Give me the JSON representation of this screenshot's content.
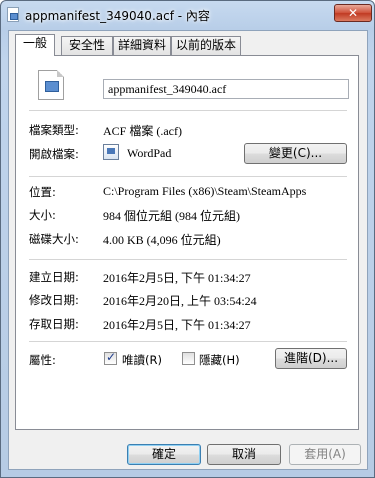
{
  "window": {
    "title": "appmanifest_349040.acf - 內容",
    "close_label": "✕"
  },
  "tabs": [
    {
      "label": "一般",
      "active": true
    },
    {
      "label": "安全性",
      "active": false
    },
    {
      "label": "詳細資料",
      "active": false
    },
    {
      "label": "以前的版本",
      "active": false
    }
  ],
  "general": {
    "file_name": "appmanifest_349040.acf",
    "type_label": "檔案類型:",
    "type_value": "ACF 檔案 (.acf)",
    "opens_with_label": "開啟檔案:",
    "opens_with_value": "WordPad",
    "change_button": "變更(C)...",
    "location_label": "位置:",
    "location_value": "C:\\Program Files (x86)\\Steam\\SteamApps",
    "size_label": "大小:",
    "size_value": "984 個位元組 (984 位元組)",
    "disk_size_label": "磁碟大小:",
    "disk_size_value": "4.00 KB (4,096 位元組)",
    "created_label": "建立日期:",
    "created_value": "2016年2月5日, 下午 01:34:27",
    "modified_label": "修改日期:",
    "modified_value": "2016年2月20日, 上午 03:54:24",
    "accessed_label": "存取日期:",
    "accessed_value": "2016年2月5日, 下午 01:34:27",
    "attributes_label": "屬性:",
    "readonly_label": "唯讀(R)",
    "readonly_checked": true,
    "hidden_label": "隱藏(H)",
    "hidden_checked": false,
    "advanced_button": "進階(D)..."
  },
  "footer": {
    "ok": "確定",
    "cancel": "取消",
    "apply": "套用(A)"
  }
}
